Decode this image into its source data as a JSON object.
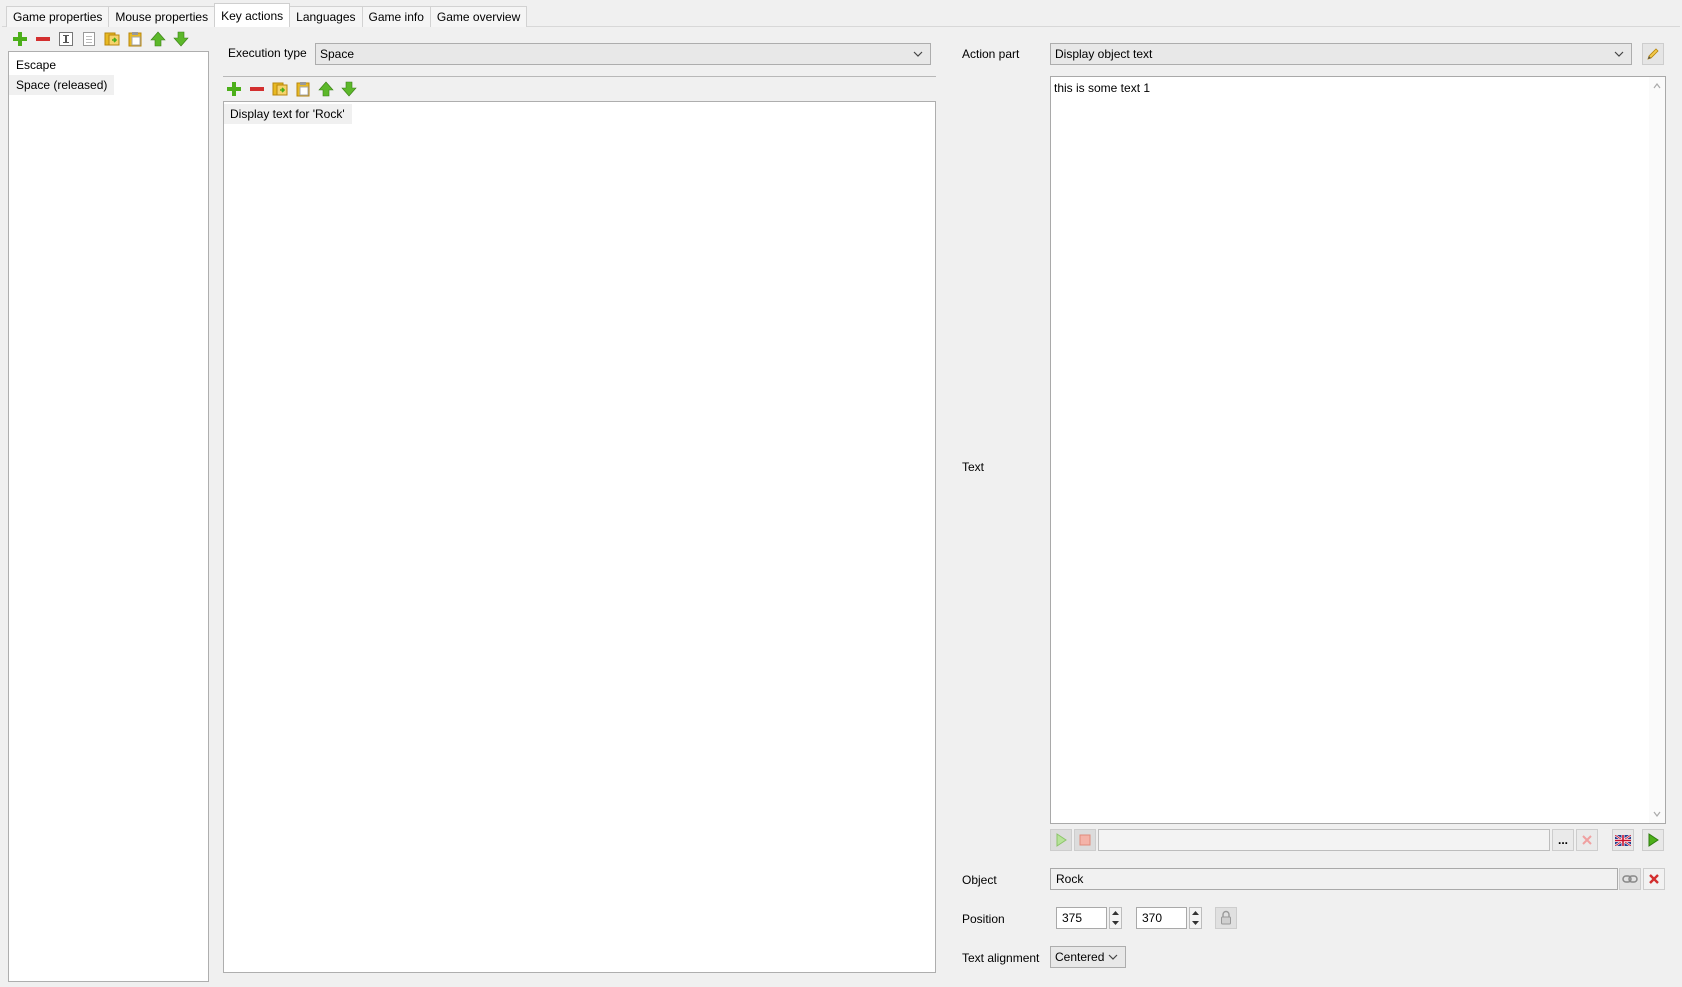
{
  "tabs": [
    {
      "label": "Game properties",
      "active": false
    },
    {
      "label": "Mouse properties",
      "active": false
    },
    {
      "label": "Key actions",
      "active": true
    },
    {
      "label": "Languages",
      "active": false
    },
    {
      "label": "Game info",
      "active": false
    },
    {
      "label": "Game overview",
      "active": false
    }
  ],
  "key_list": {
    "items": [
      "Escape",
      "Space (released)"
    ],
    "selected_index": 1
  },
  "execution": {
    "label": "Execution type",
    "value": "Space"
  },
  "actions_list": {
    "items": [
      "Display text for 'Rock'"
    ]
  },
  "action_part": {
    "label": "Action part",
    "value": "Display object text"
  },
  "text_field": {
    "label": "Text",
    "value": "this is some text 1"
  },
  "audio": {
    "path_value": "",
    "browse_label": "..."
  },
  "object_field": {
    "label": "Object",
    "value": "Rock"
  },
  "position": {
    "label": "Position",
    "x": "375",
    "y": "370"
  },
  "alignment": {
    "label": "Text alignment",
    "value": "Centered"
  },
  "colors": {
    "green": "#4caf1a",
    "red": "#d32f2f",
    "folder": "#e8b923"
  }
}
